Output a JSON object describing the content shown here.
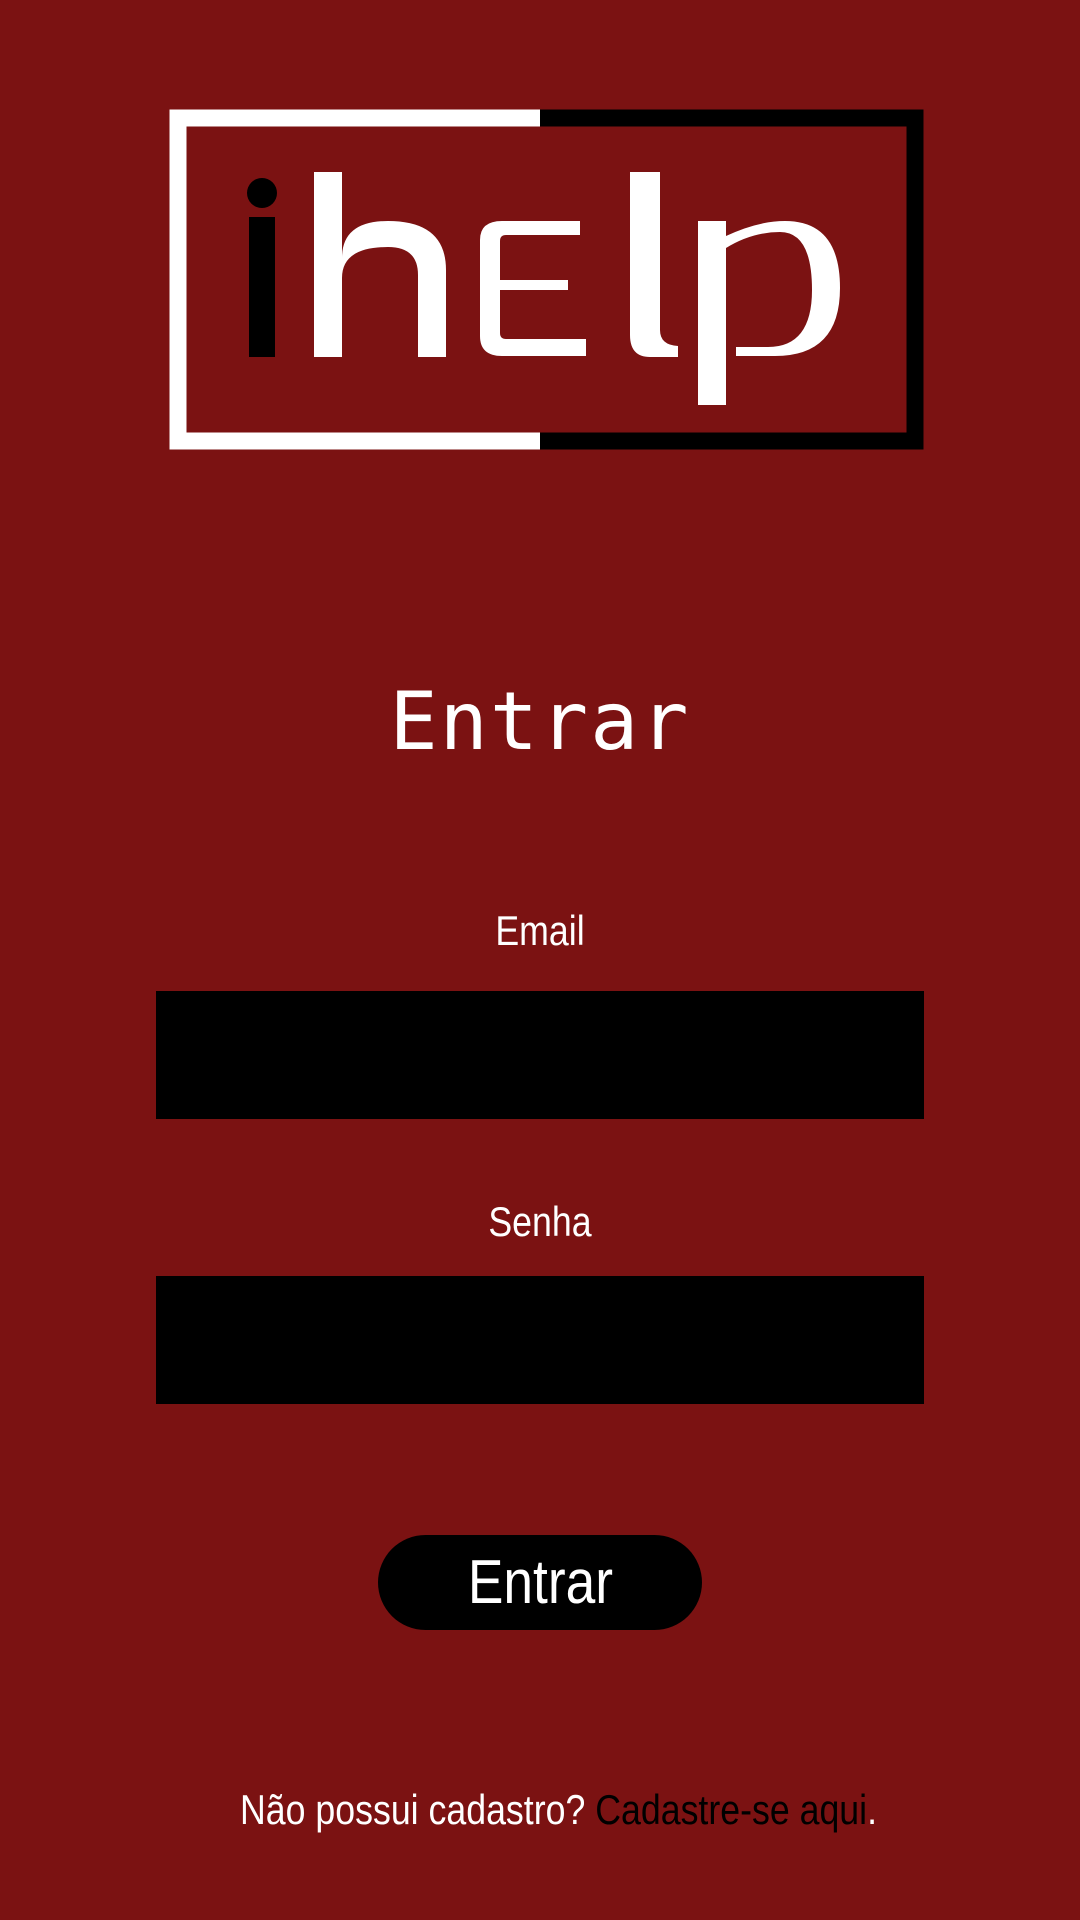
{
  "logo": {
    "text": "ihelp",
    "colors": {
      "background": "#7b1212",
      "primary": "#ffffff",
      "secondary": "#000000"
    }
  },
  "title": "Entrar",
  "form": {
    "email": {
      "label": "Email",
      "value": "",
      "placeholder": ""
    },
    "password": {
      "label": "Senha",
      "value": "",
      "placeholder": ""
    },
    "submit_label": "Entrar"
  },
  "footer": {
    "prompt": "Não possui cadastro? ",
    "link_label": "Cadastre-se aqui",
    "trailing": "."
  },
  "colors": {
    "background": "#7b1212",
    "input_background": "#000000",
    "button_background": "#000000",
    "text": "#ffffff",
    "link": "#000000"
  }
}
